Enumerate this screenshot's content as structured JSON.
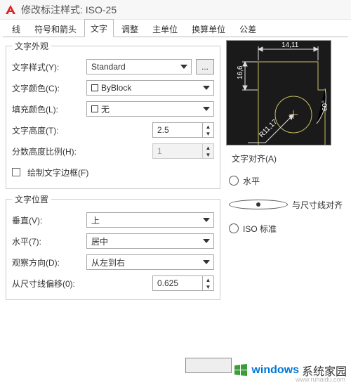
{
  "window": {
    "title": "修改标注样式: ISO-25"
  },
  "tabs": [
    "线",
    "符号和箭头",
    "文字",
    "调整",
    "主单位",
    "换算单位",
    "公差"
  ],
  "active_tab": 2,
  "appearance": {
    "legend": "文字外观",
    "style_label": "文字样式(Y):",
    "style_value": "Standard",
    "dots": "...",
    "textcolor_label": "文字颜色(C):",
    "textcolor_value": "ByBlock",
    "fillcolor_label": "填充颜色(L):",
    "fillcolor_value": "无",
    "height_label": "文字高度(T):",
    "height_value": "2.5",
    "fraction_label": "分数高度比例(H):",
    "fraction_value": "1",
    "frame_label": "绘制文字边框(F)"
  },
  "placement": {
    "legend": "文字位置",
    "vertical_label": "垂直(V):",
    "vertical_value": "上",
    "horizontal_label": "水平(7):",
    "horizontal_value": "居中",
    "viewdir_label": "观察方向(D):",
    "viewdir_value": "从左到右",
    "offset_label": "从尺寸线偏移(0):",
    "offset_value": "0.625"
  },
  "alignment": {
    "legend": "文字对齐(A)",
    "opt_h": "水平",
    "opt_dim": "与尺寸线对齐",
    "opt_iso": "ISO 标准",
    "selected": "opt_dim"
  },
  "preview": {
    "dim1": "14,11",
    "dim2": "16,6",
    "dimR": "R11,17",
    "dimA": "60°"
  },
  "watermark": {
    "t1": "windows",
    "t2": "系统家园",
    "sub": "www.ruhaidu.com"
  }
}
